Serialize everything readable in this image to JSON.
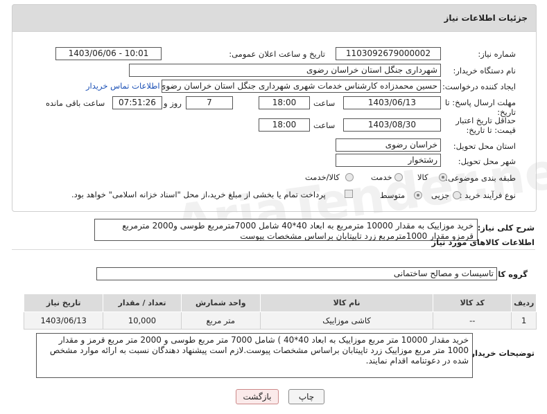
{
  "header": {
    "title": "جزئیات اطلاعات نیاز"
  },
  "fields": {
    "need_number_label": "شماره نیاز:",
    "need_number": "1103092679000002",
    "announce_label": "تاریخ و ساعت اعلان عمومی:",
    "announce_value": "1403/06/06 - 10:01",
    "buyer_org_label": "نام دستگاه خریدار:",
    "buyer_org": "شهرداری جنگل استان خراسان رضوی",
    "creator_label": "ایجاد کننده درخواست:",
    "creator": "حسین محمدزاده کارشناس خدمات شهری شهرداری جنگل استان خراسان رضوی",
    "contact_link": "اطلاعات تماس خریدار",
    "deadline_label": "مهلت ارسال پاسخ: تا تاریخ:",
    "deadline_date": "1403/06/13",
    "time_label": "ساعت",
    "deadline_time": "18:00",
    "days": "7",
    "days_label": "روز و",
    "remaining_time": "07:51:26",
    "remaining_label": "ساعت باقی مانده",
    "validity_label": "حداقل تاریخ اعتبار قیمت: تا تاریخ:",
    "validity_date": "1403/08/30",
    "validity_time": "18:00",
    "province_label": "استان محل تحویل:",
    "province": "خراسان رضوی",
    "city_label": "شهر محل تحویل:",
    "city": "رشتخوار",
    "category_label": "طبقه بندی موضوعی:",
    "category_options": [
      "کالا",
      "خدمت",
      "کالا/خدمت"
    ],
    "category_selected": "کالا",
    "process_label": "نوع فرآیند خرید :",
    "process_options": [
      "جزیی",
      "متوسط"
    ],
    "process_selected": "متوسط",
    "payment_note": "پرداخت تمام یا بخشی از مبلغ خرید،از محل \"اسناد خزانه اسلامی\" خواهد بود."
  },
  "summary": {
    "label": "شرح کلی نیاز:",
    "text": "خرید موزاییک به مقدار 10000 مترمربع به ابعاد 40*40 شامل 7000مترمربع طوسی و2000 مترمربع قرمزو مقدار 1000مترمربع زرد تاپیتابان براساس مشخصات پیوست"
  },
  "goods_info": {
    "title": "اطلاعات کالاهای مورد نیاز",
    "group_label": "گروه کالا:",
    "group_value": "تاسیسات و مصالح ساختمانی"
  },
  "table": {
    "headers": [
      "ردیف",
      "کد کالا",
      "نام کالا",
      "واحد شمارش",
      "تعداد / مقدار",
      "تاریخ نیاز"
    ],
    "rows": [
      {
        "row": "1",
        "code": "--",
        "name": "کاشی موزاییک",
        "unit": "متر مربع",
        "qty": "10,000",
        "date": "1403/06/13"
      }
    ]
  },
  "buyer_notes": {
    "label": "توضیحات خریدار:",
    "text": "خرید مقدار 10000 متر مربع موزاییک به ابعاد 40*40 ) شامل 7000 متر مربع طوسی و 2000 متر مربع قرمز  و مقدار 1000 متر مربع موزاییک زرد تاپیتابان براساس مشخصات پیوست.لازم است پیشنهاد دهندگان نسبت به ارائه موارد مشخص شده در دعوتنامه اقدام نمایند."
  },
  "buttons": {
    "print": "چاپ",
    "back": "بازگشت"
  }
}
